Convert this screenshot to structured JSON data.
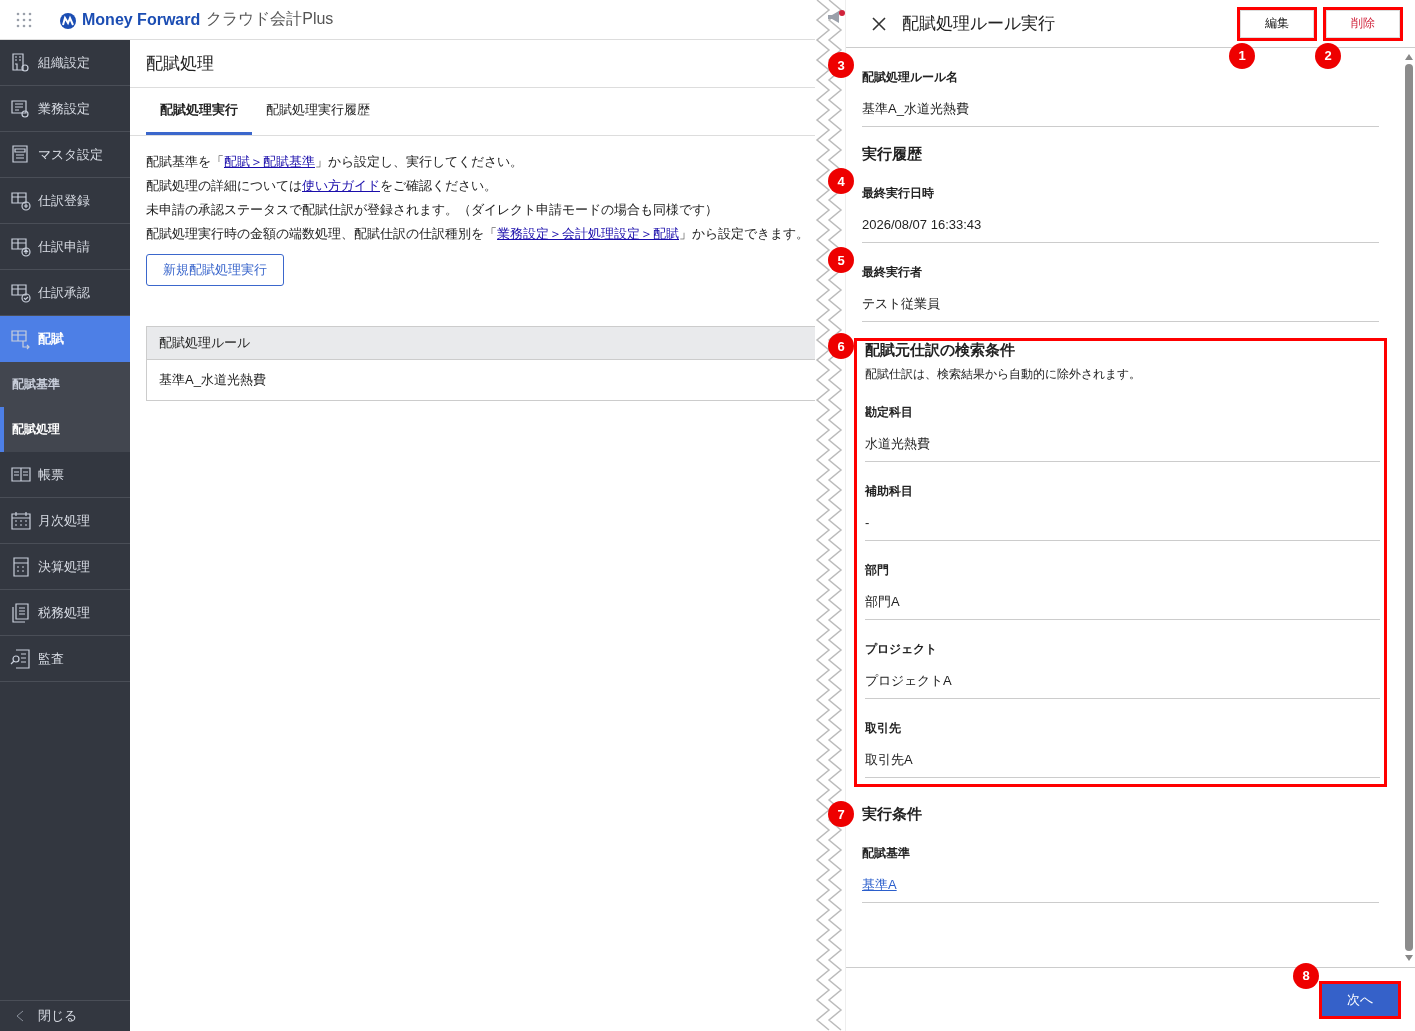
{
  "header": {
    "brand": "Money Forward",
    "product": "クラウド会計Plus"
  },
  "sidebar": {
    "items": [
      {
        "label": "組織設定",
        "kind": "org",
        "selected": false
      },
      {
        "label": "業務設定",
        "kind": "business",
        "selected": false
      },
      {
        "label": "マスタ設定",
        "kind": "master",
        "selected": false
      },
      {
        "label": "仕訳登録",
        "kind": "journal-add",
        "selected": false
      },
      {
        "label": "仕訳申請",
        "kind": "journal-request",
        "selected": false
      },
      {
        "label": "仕訳承認",
        "kind": "journal-approve",
        "selected": false
      },
      {
        "label": "配賦",
        "kind": "allocation",
        "selected": true,
        "children": [
          {
            "label": "配賦基準",
            "selected": false
          },
          {
            "label": "配賦処理",
            "selected": true
          }
        ]
      },
      {
        "label": "帳票",
        "kind": "report",
        "selected": false
      },
      {
        "label": "月次処理",
        "kind": "monthly",
        "selected": false
      },
      {
        "label": "決算処理",
        "kind": "settlement",
        "selected": false
      },
      {
        "label": "税務処理",
        "kind": "tax",
        "selected": false
      },
      {
        "label": "監査",
        "kind": "audit",
        "selected": false
      }
    ],
    "close": "閉じる"
  },
  "page": {
    "title": "配賦処理",
    "tabs": [
      {
        "label": "配賦処理実行",
        "selected": true
      },
      {
        "label": "配賦処理実行履歴",
        "selected": false
      }
    ],
    "notes": [
      [
        {
          "text": "配賦基準を「"
        },
        {
          "link": "配賦＞配賦基準"
        },
        {
          "text": "」から設定し、実行してください。"
        }
      ],
      [
        {
          "text": "配賦処理の詳細については"
        },
        {
          "link": "使い方ガイド"
        },
        {
          "text": "をご確認ください。"
        }
      ],
      [
        {
          "text": "未申請の承認ステータスで配賦仕訳が登録されます。（ダイレクト申請モードの場合も同様です）"
        }
      ],
      [
        {
          "text": "配賦処理実行時の金額の端数処理、配賦仕訳の仕訳種別を「"
        },
        {
          "link": "業務設定＞会計処理設定＞配賦"
        },
        {
          "text": "」から設定できます。"
        }
      ]
    ],
    "new_button": "新規配賦処理実行",
    "table": {
      "columns": [
        "配賦処理ルール"
      ],
      "rows": [
        [
          "基準A_水道光熱費"
        ]
      ]
    }
  },
  "panel": {
    "title": "配賦処理ルール実行",
    "buttons": [
      {
        "label": "編集",
        "kind": "normal",
        "highlighted": true,
        "badge": "1"
      },
      {
        "label": "削除",
        "kind": "danger",
        "highlighted": true,
        "badge": "2"
      }
    ],
    "sections": [
      {
        "fields": [
          {
            "label": "配賦処理ルール名",
            "value": "基準A_水道光熱費",
            "badge": "3"
          }
        ]
      },
      {
        "heading": "実行履歴",
        "fields": [
          {
            "label": "最終実行日時",
            "value": "2026/08/07 16:33:43",
            "badge": "4"
          },
          {
            "label": "最終実行者",
            "value": "テスト従業員",
            "badge": "5"
          }
        ]
      },
      {
        "heading": "配賦元仕訳の検索条件",
        "badge": "6",
        "highlighted": true,
        "note": "配賦仕訳は、検索結果から自動的に除外されます。",
        "fields": [
          {
            "label": "勘定科目",
            "value": "水道光熱費"
          },
          {
            "label": "補助科目",
            "value": "-"
          },
          {
            "label": "部門",
            "value": "部門A"
          },
          {
            "label": "プロジェクト",
            "value": "プロジェクトA"
          },
          {
            "label": "取引先",
            "value": "取引先A"
          }
        ]
      },
      {
        "heading": "実行条件",
        "badge": "7",
        "fields": [
          {
            "label": "配賦基準",
            "value": "基準A",
            "kind": "link"
          }
        ]
      }
    ],
    "next": {
      "label": "次へ",
      "highlighted": true,
      "badge": "8"
    }
  }
}
